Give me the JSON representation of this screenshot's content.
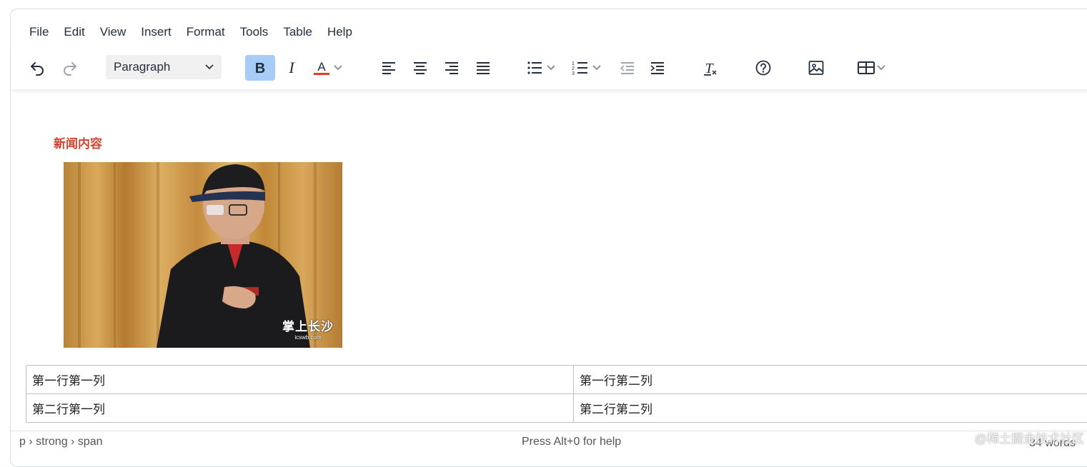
{
  "menubar": [
    "File",
    "Edit",
    "View",
    "Insert",
    "Format",
    "Tools",
    "Table",
    "Help"
  ],
  "toolbar": {
    "block_format": "Paragraph",
    "icons": [
      "undo-icon",
      "redo-icon",
      "bold-icon",
      "italic-icon",
      "text-color-icon",
      "align-left-icon",
      "align-center-icon",
      "align-right-icon",
      "justify-icon",
      "bullet-list-icon",
      "numbered-list-icon",
      "outdent-icon",
      "indent-icon",
      "remove-format-icon",
      "help-icon",
      "image-icon",
      "table-icon"
    ],
    "text_color": "#e03e2d",
    "active_color": "#a6ccf7"
  },
  "content": {
    "heading": "新闻内容",
    "heading_color": "#d0452f",
    "image_watermark": "掌上长沙",
    "image_watermark_url": "icswb.com",
    "table": [
      [
        "第一行第一列",
        "第一行第二列"
      ],
      [
        "第二行第一列",
        "第二行第二列"
      ]
    ]
  },
  "statusbar": {
    "path": "p › strong › span",
    "help": "Press Alt+0 for help",
    "words": "34 words"
  },
  "site_watermark": "@稀土掘金技术社区"
}
